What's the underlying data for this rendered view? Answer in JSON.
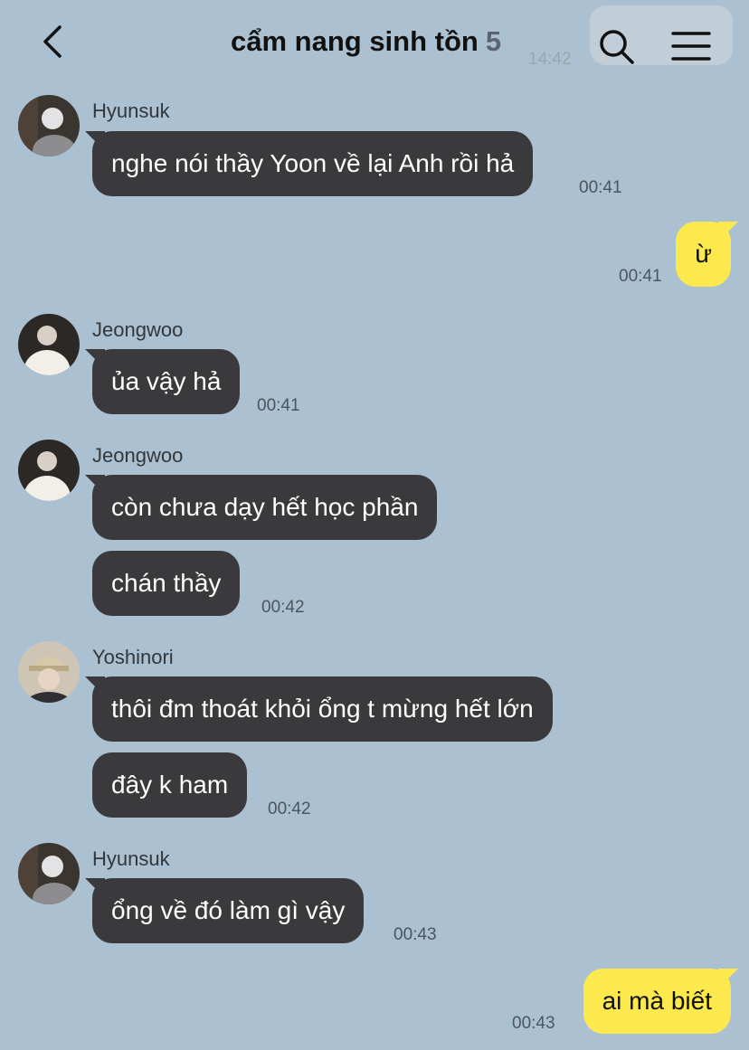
{
  "header": {
    "title": "cẩm nang sinh tồn",
    "member_count": "5",
    "ghost_time": "14:42",
    "icons": {
      "back": "chevron-left-icon",
      "search": "search-icon",
      "menu": "menu-icon"
    }
  },
  "colors": {
    "background": "#abc1d1",
    "received_bubble": "#3a3a3c",
    "sent_bubble": "#fbe94e"
  },
  "messages": [
    {
      "sender": "Hyunsuk",
      "text": "nghe nói thầy Yoon về lại Anh rồi hả",
      "time": "00:41"
    },
    {
      "text": "ừ",
      "time": "00:41",
      "mine": true
    },
    {
      "sender": "Jeongwoo",
      "text": "ủa vậy hả",
      "time": "00:41"
    },
    {
      "sender": "Jeongwoo",
      "text": "còn chưa dạy hết học phần"
    },
    {
      "text": "chán thầy",
      "time": "00:42"
    },
    {
      "sender": "Yoshinori",
      "text": "thôi đm thoát khỏi ổng t mừng hết lớn"
    },
    {
      "text": "đây k ham",
      "time": "00:42"
    },
    {
      "sender": "Hyunsuk",
      "text": "ổng về đó làm gì vậy",
      "time": "00:43"
    },
    {
      "text": "ai mà biết",
      "time": "00:43",
      "mine": true
    }
  ]
}
